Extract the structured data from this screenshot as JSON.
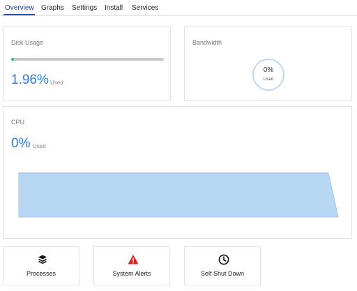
{
  "tabs": [
    {
      "label": "Overview",
      "active": true
    },
    {
      "label": "Graphs"
    },
    {
      "label": "Settings"
    },
    {
      "label": "Install"
    },
    {
      "label": "Services"
    }
  ],
  "disk": {
    "title": "Disk Usage",
    "value": "1.96%",
    "used_label": "Used",
    "percent": 1.96
  },
  "bandwidth": {
    "title": "Bandwidth",
    "value": "0%",
    "used_label": "Used",
    "percent": 0
  },
  "cpu": {
    "title": "CPU",
    "value": "0%",
    "used_label": "Used"
  },
  "actions": [
    {
      "label": "Processes",
      "icon": "layers-icon"
    },
    {
      "label": "System Alerts",
      "icon": "warning-icon"
    },
    {
      "label": "Self Shut Down",
      "icon": "clock-icon"
    }
  ],
  "colors": {
    "accent": "#2f7bd6",
    "tab_active": "#2a4fb0",
    "disk_fill": "#27c08a",
    "gauge_ring": "#bcd9f2",
    "cpu_area": "#b7d7f3",
    "cpu_line": "#9fc6ec",
    "alert": "#e0201b"
  }
}
